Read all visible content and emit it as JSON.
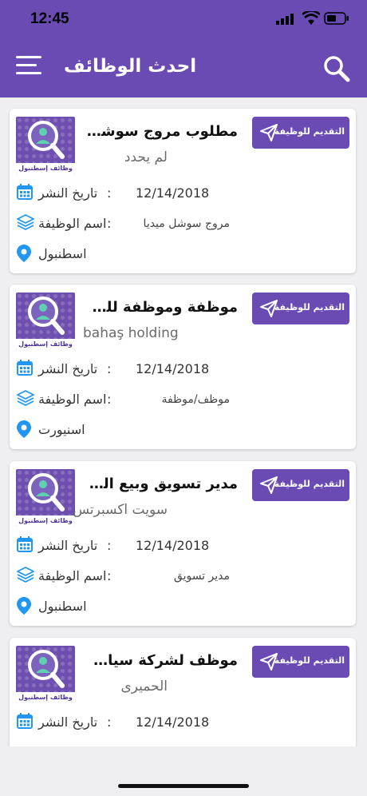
{
  "status_bar": {
    "time": "12:45"
  },
  "header": {
    "title": "احدث الوظائف"
  },
  "labels": {
    "publish_date": "تاريخ النشر",
    "job_name": "اسم الوظيفة",
    "colon": ":",
    "apply": "التقديم للوظيفة",
    "logo_caption": "وظائف إسطنبول"
  },
  "jobs": [
    {
      "title": "مطلوب مروج سوشل ميديا",
      "company": "لم يحدد",
      "date": "12/14/2018",
      "job_name": "مروج سوشل ميديا",
      "location": "اسطنبول"
    },
    {
      "title": "موظفة وموظفة للعمل فى...",
      "company": "bahaş holding",
      "date": "12/14/2018",
      "job_name": "موظف/موظفة",
      "location": "اسنيورت"
    },
    {
      "title": "مدير تسويق وبيع المنتجا...",
      "company": "سويت اكسبرتس",
      "date": "12/14/2018",
      "job_name": "مدير تسويق",
      "location": "اسطنبول"
    },
    {
      "title": "موظف لشركة سياحة وسفر",
      "company": "الحميرى",
      "date": "12/14/2018",
      "job_name": "",
      "location": ""
    }
  ],
  "colors": {
    "primary": "#6a4bb3",
    "icon_blue": "#2196f3",
    "background": "#efeff2"
  }
}
